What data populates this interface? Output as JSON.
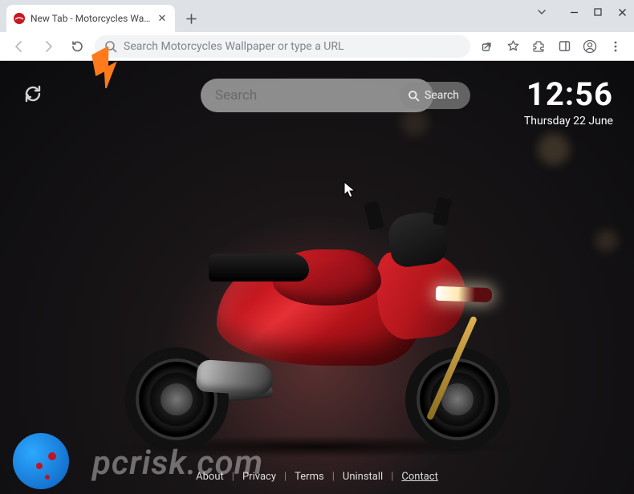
{
  "window": {
    "tab_title": "New Tab - Motorcycles Wallpape"
  },
  "urlbar": {
    "placeholder": "Search Motorcycles Wallpaper or type a URL"
  },
  "overlay": {
    "search_placeholder": "Search",
    "search_button": "Search",
    "clock_time": "12:56",
    "clock_date": "Thursday 22 June"
  },
  "footer": {
    "links": [
      "About",
      "Privacy",
      "Terms",
      "Uninstall",
      "Contact"
    ]
  },
  "watermark": "pcrisk.com"
}
